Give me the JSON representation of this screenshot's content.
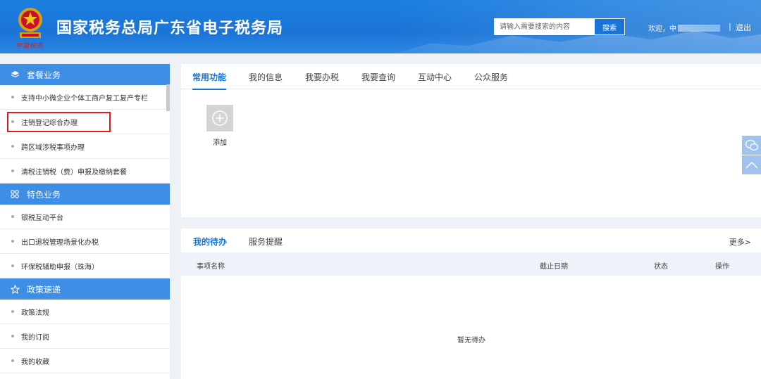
{
  "header": {
    "title": "国家税务总局广东省电子税务局",
    "search_placeholder": "请输入需要搜索的内容",
    "search_button": "搜索",
    "welcome": "欢迎，中",
    "separator": "|",
    "logout": "退出",
    "brand_color": "#1a74d6"
  },
  "sidebar": {
    "sections": [
      {
        "title": "套餐业务",
        "icon": "layers-icon",
        "items": [
          "支持中小微企业个体工商户复工复产专栏",
          "注销登记综合办理",
          "跨区域涉税事项办理",
          "清税注销税（费）申报及缴纳套餐"
        ]
      },
      {
        "title": "特色业务",
        "icon": "grid-icon",
        "items": [
          "银税互动平台",
          "出口退税管理场景化办税",
          "环保税辅助申报（珠海）"
        ]
      },
      {
        "title": "政策速递",
        "icon": "star-icon",
        "items": [
          "政策法规",
          "我的订阅",
          "我的收藏"
        ]
      }
    ],
    "highlighted_item": "注销登记综合办理"
  },
  "main_tabs": [
    "常用功能",
    "我的信息",
    "我要办税",
    "我要查询",
    "互动中心",
    "公众服务"
  ],
  "common_functions": {
    "add_label": "添加"
  },
  "todo": {
    "tabs": [
      "我的待办",
      "服务提醒"
    ],
    "more": "更多>",
    "columns": [
      "事项名称",
      "截止日期",
      "状态",
      "操作"
    ],
    "empty_text": "暂无待办"
  }
}
